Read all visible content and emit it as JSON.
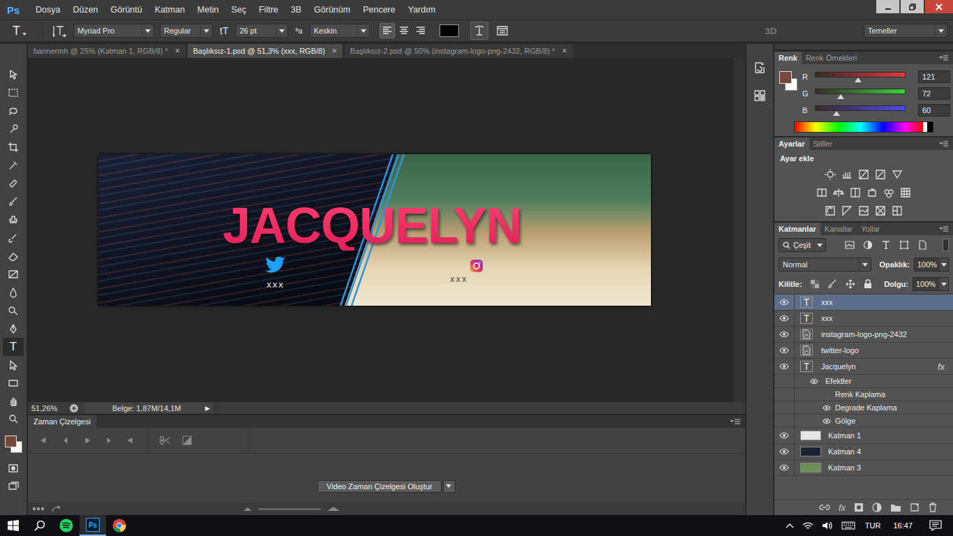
{
  "app": {
    "logo": "Ps"
  },
  "menu": [
    "Dosya",
    "Düzen",
    "Görüntü",
    "Katman",
    "Metin",
    "Seç",
    "Filtre",
    "3B",
    "Görünüm",
    "Pencere",
    "Yardım"
  ],
  "options_bar": {
    "tool_glyph": "T",
    "font_family": "Myriad Pro",
    "font_style": "Regular",
    "size_glyph": "tT",
    "font_size": "26 pt",
    "aa_glyph": "ªa",
    "antialias": "Keskin",
    "align": [
      {
        "selected": true
      },
      {
        "selected": false
      },
      {
        "selected": false
      }
    ],
    "text_color": "#000000",
    "mode_3d": "3D",
    "workspace": "Temeller"
  },
  "tabs": [
    {
      "label": "bannermh @ 25% (Katman 1, RGB/8) *",
      "selected": false,
      "close": "×"
    },
    {
      "label": "Başlıksız-1.psd @ 51,3% (xxx, RGB/8)",
      "selected": true,
      "close": "×"
    },
    {
      "label": "Başlıksız-2.psd @ 50% (instagram-logo-png-2432, RGB/8) *",
      "selected": false,
      "close": "×"
    }
  ],
  "tools": [
    {
      "kind": "move",
      "selected": false
    },
    {
      "kind": "marquee",
      "selected": false
    },
    {
      "kind": "lasso",
      "selected": false
    },
    {
      "kind": "quick",
      "selected": false
    },
    {
      "kind": "crop",
      "selected": false
    },
    {
      "kind": "eyedropper",
      "selected": false
    },
    {
      "kind": "healing",
      "selected": false
    },
    {
      "kind": "brush",
      "selected": false
    },
    {
      "kind": "stamp",
      "selected": false
    },
    {
      "kind": "history",
      "selected": false
    },
    {
      "kind": "eraser",
      "selected": false
    },
    {
      "kind": "gradient",
      "selected": false
    },
    {
      "kind": "blur",
      "selected": false
    },
    {
      "kind": "dodge",
      "selected": false
    },
    {
      "kind": "pen",
      "selected": false
    },
    {
      "kind": "type",
      "selected": true,
      "glyph": "T"
    },
    {
      "kind": "pathselect",
      "selected": false
    },
    {
      "kind": "shape",
      "selected": false
    },
    {
      "kind": "hand",
      "selected": false
    },
    {
      "kind": "zoom",
      "selected": false
    }
  ],
  "document": {
    "title": "JACQUELYN",
    "social": [
      {
        "kind": "twitter",
        "handle": "xxx"
      },
      {
        "kind": "instagram",
        "handle": "xxx"
      }
    ]
  },
  "status_bar": {
    "zoom": "51,26%",
    "document_size": "Belge: 1,87M/14,1M",
    "arrow": "▶"
  },
  "timeline": {
    "title": "Zaman Çizelgesi",
    "create_button": "Video Zaman Çizelgesi Oluştur"
  },
  "color_panel": {
    "tabs": [
      {
        "label": "Renk",
        "selected": true
      },
      {
        "label": "Renk Örnekleri",
        "selected": false
      }
    ],
    "foreground": "#79483c",
    "background": "#ffffff",
    "channels": [
      {
        "name": "R",
        "value": "121",
        "level": 0.475,
        "color": "#e03a3a"
      },
      {
        "name": "G",
        "value": "72",
        "level": 0.282,
        "color": "#3ad23a"
      },
      {
        "name": "B",
        "value": "60",
        "level": 0.235,
        "color": "#4a4af0"
      }
    ]
  },
  "adjustments_panel": {
    "tabs": [
      {
        "label": "Ayarlar",
        "selected": true
      },
      {
        "label": "Stiller",
        "selected": false
      }
    ],
    "heading": "Ayar ekle"
  },
  "layers_panel": {
    "tabs": [
      {
        "label": "Katmanlar",
        "selected": true
      },
      {
        "label": "Kanallar",
        "selected": false
      },
      {
        "label": "Yollar",
        "selected": false
      }
    ],
    "filter": "Çeşit",
    "blend_mode": "Normal",
    "opacity_label": "Opaklık:",
    "opacity": "100%",
    "lock_label": "Kilitle:",
    "fill_label": "Dolgu:",
    "fill": "100%",
    "footer_fx": "fx",
    "layers": [
      {
        "name": "xxx",
        "kind": "text",
        "visible": true,
        "selected": true,
        "thumb_glyph": "T"
      },
      {
        "name": "xxx",
        "kind": "text",
        "visible": true,
        "selected": false,
        "thumb_glyph": "T"
      },
      {
        "name": "instagram-logo-png-2432",
        "kind": "smart",
        "visible": true,
        "selected": false
      },
      {
        "name": "twitter-logo",
        "kind": "smart",
        "visible": true,
        "selected": false
      },
      {
        "name": "Jacquelyn",
        "kind": "text",
        "visible": true,
        "selected": false,
        "thumb_glyph": "T",
        "badge": "fx"
      },
      {
        "name": "Efektler",
        "kind": "effects",
        "visible": true,
        "selected": false
      },
      {
        "name": "Renk Kaplama",
        "kind": "effect",
        "visible": false,
        "selected": false
      },
      {
        "name": "Degrade Kaplama",
        "kind": "effect",
        "visible": true,
        "selected": false
      },
      {
        "name": "Gölge",
        "kind": "effect",
        "visible": true,
        "selected": false
      },
      {
        "name": "Katman 1",
        "kind": "pixel",
        "visible": true,
        "selected": false,
        "color": "#e4e4e4"
      },
      {
        "name": "Katman 4",
        "kind": "pixel",
        "visible": true,
        "selected": false,
        "color": "#1c2233"
      },
      {
        "name": "Katman 3",
        "kind": "pixel",
        "visible": true,
        "selected": false,
        "color": "#6f8f5a"
      }
    ]
  },
  "taskbar": {
    "ps_glyph": "Ps",
    "language": "TUR",
    "time": "16:47"
  }
}
